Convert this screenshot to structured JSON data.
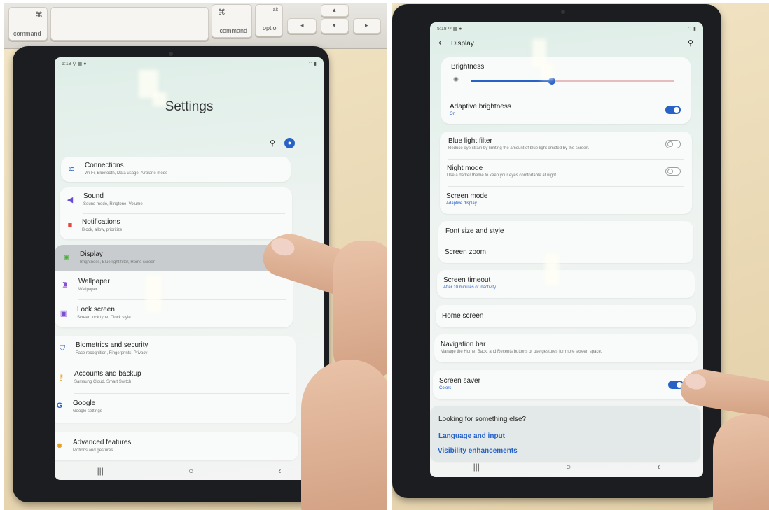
{
  "left_photo": {
    "keyboard": {
      "command_left": "command",
      "cmd_symbol": "⌘",
      "command_right": "command",
      "option": "option",
      "alt": "alt"
    },
    "status": {
      "time": "5:18",
      "icons_left": "⚲ ▦ ●",
      "icons_right": "⌔ ▮"
    },
    "page_title": "Settings",
    "items": [
      {
        "title": "Connections",
        "subtitle": "Wi-Fi, Bluetooth, Data usage, Airplane mode"
      },
      {
        "title": "Sound",
        "subtitle": "Sound mode, Ringtone, Volume"
      },
      {
        "title": "Notifications",
        "subtitle": "Block, allow, prioritize"
      },
      {
        "title": "Display",
        "subtitle": "Brightness, Blue light filter, Home screen"
      },
      {
        "title": "Wallpaper",
        "subtitle": "Wallpaper"
      },
      {
        "title": "Lock screen",
        "subtitle": "Screen lock type, Clock style"
      },
      {
        "title": "Biometrics and security",
        "subtitle": "Face recognition, Fingerprints, Privacy"
      },
      {
        "title": "Accounts and backup",
        "subtitle": "Samsung Cloud, Smart Switch"
      },
      {
        "title": "Google",
        "subtitle": "Google settings"
      },
      {
        "title": "Advanced features",
        "subtitle": "Motions and gestures"
      }
    ],
    "nav": {
      "recents": "|||",
      "home": "○",
      "back": "‹"
    }
  },
  "right_photo": {
    "status": {
      "time": "5:18",
      "icons_left": "⚲ ▦ ●",
      "icons_right": "⌔ ▮"
    },
    "header": {
      "back": "‹",
      "title": "Display"
    },
    "brightness": {
      "label": "Brightness",
      "level": 0.4
    },
    "adaptive": {
      "title": "Adaptive brightness",
      "subtitle": "On",
      "on": true
    },
    "blue_light": {
      "title": "Blue light filter",
      "subtitle": "Reduce eye strain by limiting the amount of blue light emitted by the screen.",
      "on": false
    },
    "night_mode": {
      "title": "Night mode",
      "subtitle": "Use a darker theme to keep your eyes comfortable at night.",
      "on": false
    },
    "screen_mode": {
      "title": "Screen mode",
      "subtitle": "Adaptive display"
    },
    "font": {
      "title": "Font size and style"
    },
    "zoom": {
      "title": "Screen zoom"
    },
    "timeout": {
      "title": "Screen timeout",
      "subtitle": "After 10 minutes of inactivity"
    },
    "home": {
      "title": "Home screen"
    },
    "navbar_item": {
      "title": "Navigation bar",
      "subtitle": "Manage the Home, Back, and Recents buttons or use gestures for more screen space."
    },
    "saver": {
      "title": "Screen saver",
      "subtitle": "Colors",
      "on": true
    },
    "looking": {
      "title": "Looking for something else?",
      "links": [
        "Language and input",
        "Visibility enhancements"
      ]
    },
    "nav": {
      "recents": "|||",
      "home": "○",
      "back": "‹"
    }
  },
  "colors": {
    "accent": "#2962c7",
    "highlight": "#c9ccce"
  }
}
